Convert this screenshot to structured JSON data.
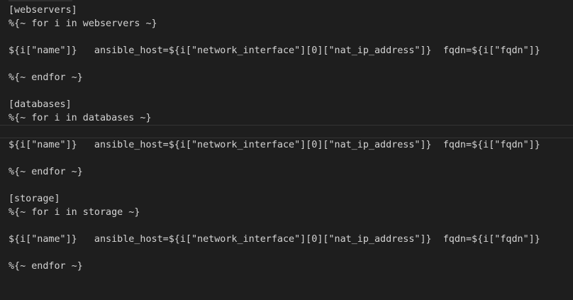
{
  "editor": {
    "lines": [
      "[webservers]",
      "%{~ for i in webservers ~}",
      "",
      "${i[\"name\"]}   ansible_host=${i[\"network_interface\"][0][\"nat_ip_address\"]}  fqdn=${i[\"fqdn\"]}",
      "",
      "%{~ endfor ~}",
      "",
      "[databases]",
      "%{~ for i in databases ~}",
      "",
      "${i[\"name\"]}   ansible_host=${i[\"network_interface\"][0][\"nat_ip_address\"]}  fqdn=${i[\"fqdn\"]}",
      "",
      "%{~ endfor ~}",
      "",
      "[storage]",
      "%{~ for i in storage ~}",
      "",
      "${i[\"name\"]}   ansible_host=${i[\"network_interface\"][0][\"nat_ip_address\"]}  fqdn=${i[\"fqdn\"]}",
      "",
      "%{~ endfor ~}"
    ],
    "colors": {
      "background": "#1e1e1e",
      "text": "#d4d4d4",
      "current_line_border": "#333333"
    }
  }
}
